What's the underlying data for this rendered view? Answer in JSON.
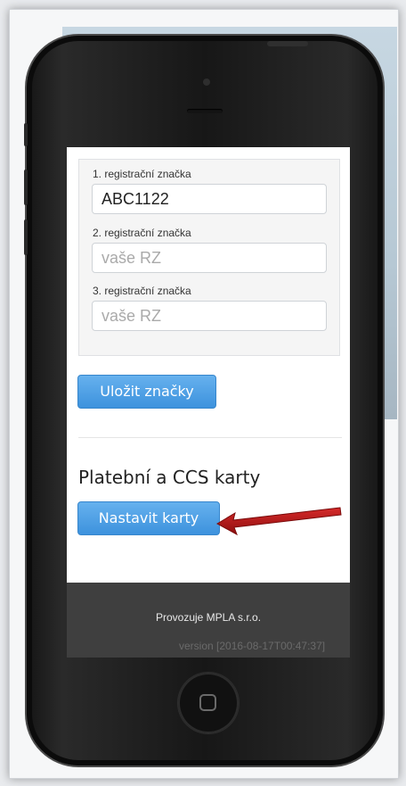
{
  "form": {
    "plate1_label": "1. registrační značka",
    "plate1_value": "ABC1122",
    "plate2_label": "2. registrační značka",
    "plate2_placeholder": "vaše RZ",
    "plate3_label": "3. registrační značka",
    "plate3_placeholder": "vaše RZ",
    "save_button": "Uložit značky"
  },
  "cards": {
    "heading": "Platební a CCS karty",
    "set_button": "Nastavit karty"
  },
  "footer": {
    "operator": "Provozuje MPLA s.r.o.",
    "version": "version [2016-08-17T00:47:37]"
  },
  "colors": {
    "button_blue": "#4a9ee6",
    "annotation_arrow": "#b01818"
  },
  "icons": {
    "annotation": "red-arrow-icon",
    "home": "home-button-icon"
  }
}
